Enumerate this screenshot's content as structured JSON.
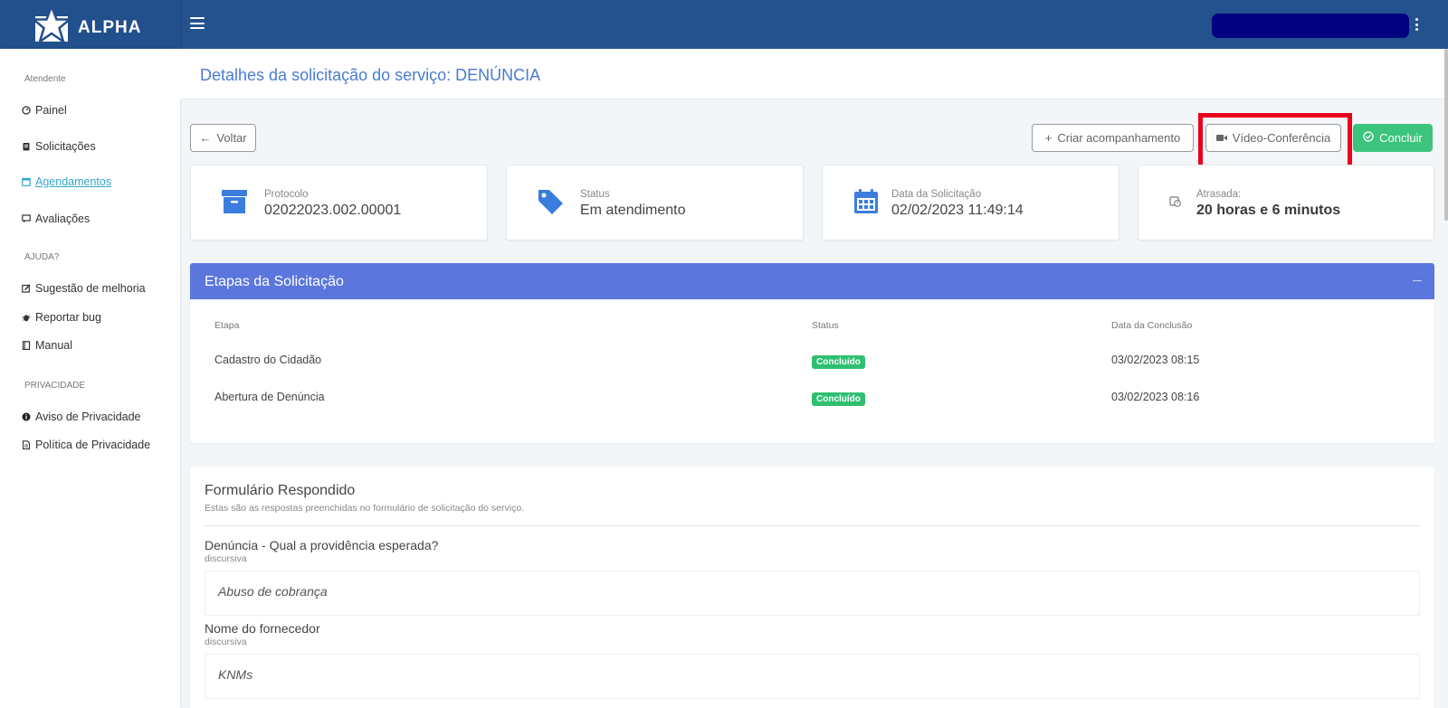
{
  "app": {
    "brand": "ALPHA"
  },
  "sidebar": {
    "sections": [
      {
        "label": "Atendente"
      },
      {
        "label": "AJUDA?"
      },
      {
        "label": "PRIVACIDADE"
      }
    ],
    "items": [
      {
        "label": "Painel",
        "icon": "dashboard-icon"
      },
      {
        "label": "Solicitações",
        "icon": "clipboard-icon"
      },
      {
        "label": " Agendamentos",
        "icon": "calendar-icon",
        "active": true
      },
      {
        "label": "Avaliações",
        "icon": "comment-icon"
      },
      {
        "label": "Sugestão de melhoria",
        "icon": "edit-icon"
      },
      {
        "label": "Reportar bug",
        "icon": "bug-icon"
      },
      {
        "label": "Manual",
        "icon": "book-icon"
      },
      {
        "label": "Aviso de Privacidade",
        "icon": "info-icon"
      },
      {
        "label": "Política de Privacidade",
        "icon": "document-icon"
      }
    ]
  },
  "page": {
    "title": "Detalhes da solicitação do serviço: DENÚNCIA"
  },
  "toolbar": {
    "back_label": "Voltar",
    "follow_label": "Criar acompanhamento",
    "video_label": "Vídeo-Conferência",
    "conclude_label": "Concluir"
  },
  "cards": [
    {
      "label": "Protocolo",
      "value": "02022023.002.00001",
      "icon": "archive-icon",
      "color": "#3b7ddd"
    },
    {
      "label": "Status",
      "value": "Em atendimento",
      "icon": "tag-icon",
      "color": "#3b7ddd"
    },
    {
      "label": "Data da Solicitação",
      "value": "02/02/2023 11:49:14",
      "icon": "calendar-icon",
      "color": "#3b7ddd"
    },
    {
      "label": "Atrasada:",
      "value": "20 horas e 6 minutos",
      "icon": "clock-icon",
      "color": "#888888"
    }
  ],
  "steps": {
    "title": "Etapas da Solicitação",
    "headers": [
      "Etapa",
      "Status",
      "Data da Conclusão"
    ],
    "rows": [
      {
        "etapa": "Cadastro do Cidadão",
        "status": "Concluído",
        "data": "03/02/2023 08:15"
      },
      {
        "etapa": "Abertura de Denúncia",
        "status": "Concluído",
        "data": "03/02/2023 08:16"
      }
    ]
  },
  "form": {
    "title": "Formulário Respondido",
    "subtitle": "Estas são as respostas preenchidas no formulário de solicitação do serviço.",
    "questions": [
      {
        "question": "Denúncia - Qual a providência esperada?",
        "type": "discursiva",
        "answer": "Abuso de cobrança"
      },
      {
        "question": "Nome do fornecedor",
        "type": "discursiva",
        "answer": "KNMs"
      }
    ]
  },
  "colors": {
    "topbar": "#24528f",
    "accent": "#5b76dc",
    "success": "#3cc47c",
    "highlight": "#e8001c"
  }
}
